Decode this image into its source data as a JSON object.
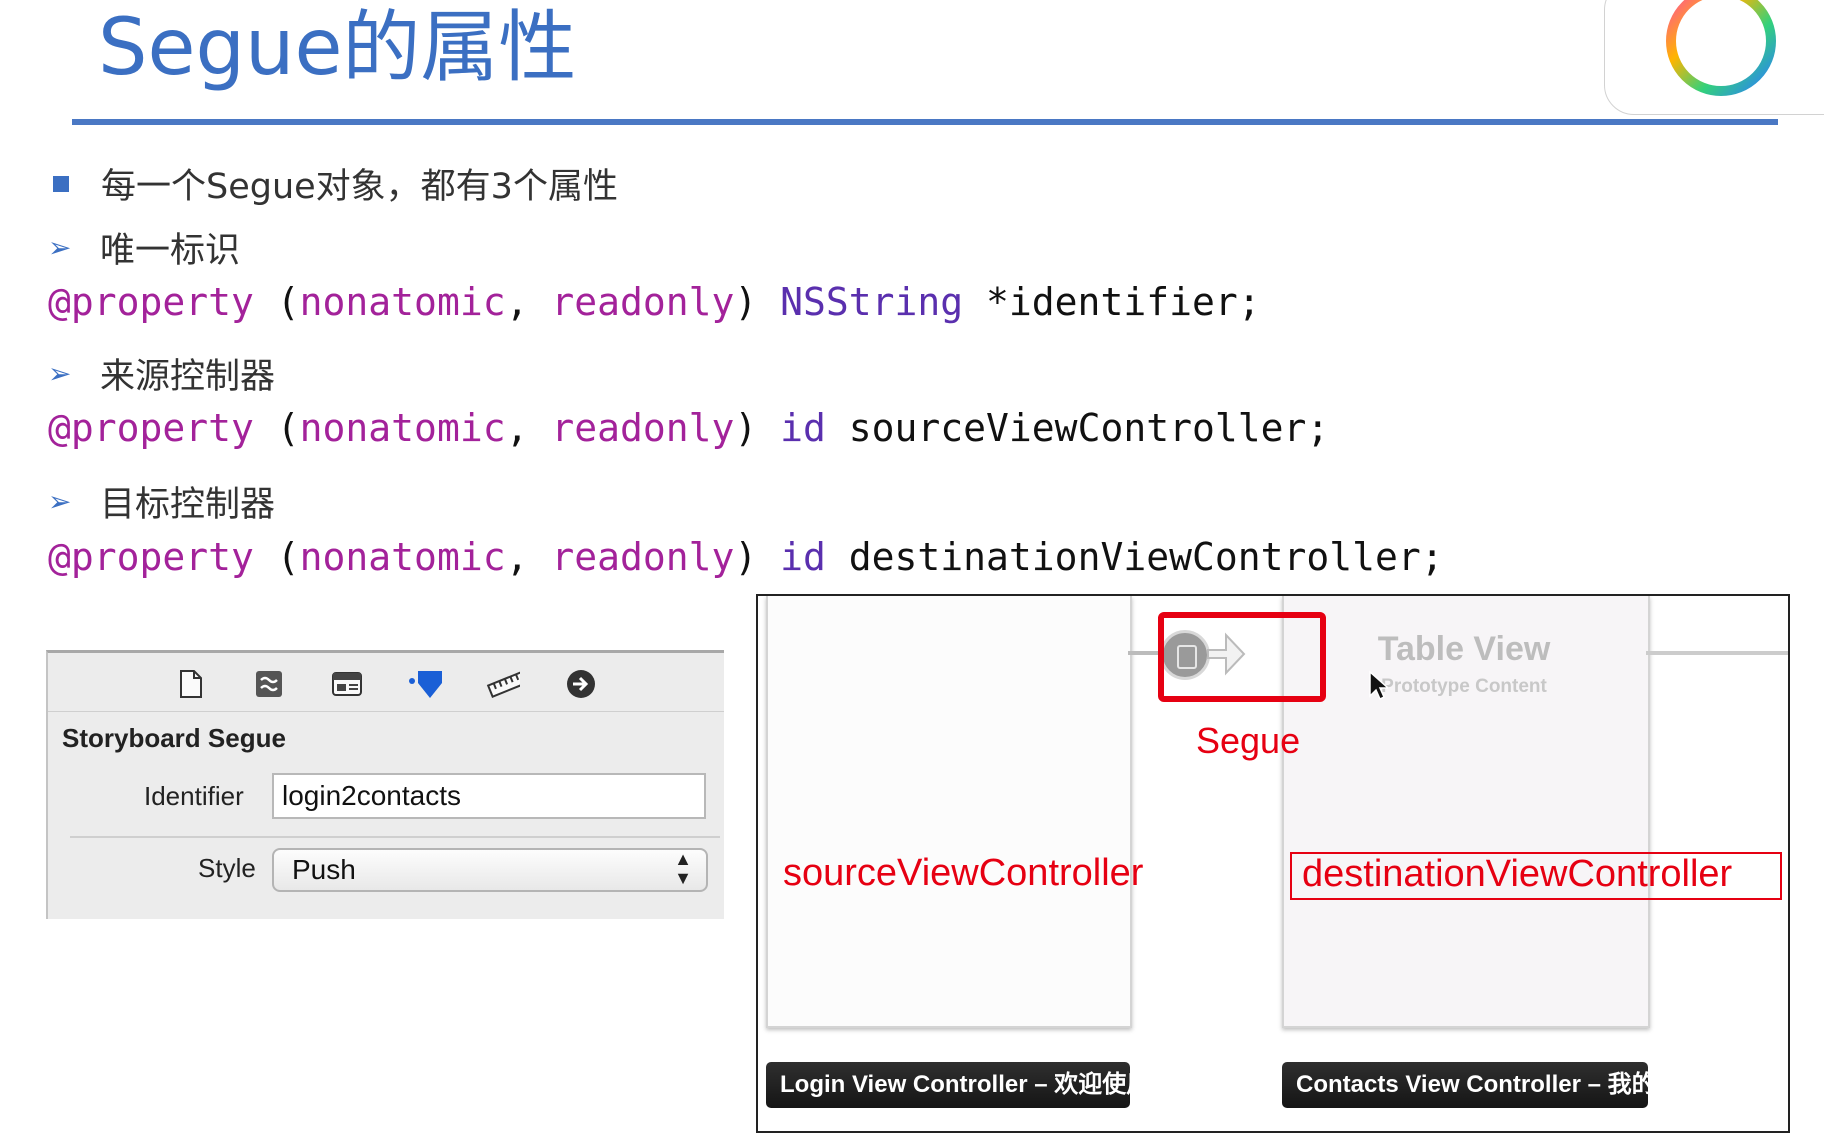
{
  "slide": {
    "title": "Segue的属性",
    "lines": [
      {
        "type": "bullet",
        "text": "每一个Segue对象，都有3个属性"
      },
      {
        "type": "sub",
        "text": "唯一标识"
      },
      {
        "type": "code",
        "kw": "@property",
        "paren_open": " (",
        "attr1": "nonatomic",
        "comma": ", ",
        "attr2": "readonly",
        "paren_close": ") ",
        "type_name": "NSString",
        "rest": " *identifier;"
      },
      {
        "type": "sub",
        "text": "来源控制器"
      },
      {
        "type": "code",
        "kw": "@property",
        "paren_open": " (",
        "attr1": "nonatomic",
        "comma": ", ",
        "attr2": "readonly",
        "paren_close": ") ",
        "type_name": "id",
        "rest": " sourceViewController;"
      },
      {
        "type": "sub",
        "text": "目标控制器"
      },
      {
        "type": "code",
        "kw": "@property",
        "paren_open": " (",
        "attr1": "nonatomic",
        "comma": ", ",
        "attr2": "readonly",
        "paren_close": ") ",
        "type_name": "id",
        "rest": " destinationViewController;"
      }
    ]
  },
  "inspector": {
    "toolbar_icons": [
      "file-icon",
      "quick-help-icon",
      "identity-icon",
      "attributes-icon",
      "size-ruler-icon",
      "connections-icon"
    ],
    "section_title": "Storyboard Segue",
    "identifier_label": "Identifier",
    "identifier_value": "login2contacts",
    "style_label": "Style",
    "style_value": "Push"
  },
  "storyboard": {
    "segue_label": "Segue",
    "source_label": "sourceViewController",
    "destination_label": "destinationViewController",
    "table_view_title": "Table View",
    "table_view_subtitle": "Prototype Content",
    "left_scene_name": "Login View Controller – 欢迎使用",
    "right_scene_name": "Contacts View Controller – 我的"
  },
  "colors": {
    "title_blue": "#3b6fc2",
    "keyword_purple": "#a3229a",
    "type_purple": "#5a2fae",
    "highlight_red": "#e60012"
  }
}
